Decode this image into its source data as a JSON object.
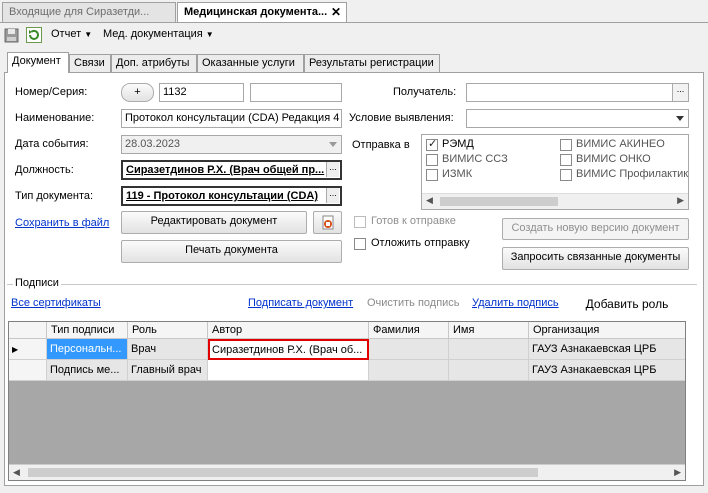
{
  "doc_tabs": [
    {
      "label": "Входящие  для  Сиразетди..."
    },
    {
      "label": "Медицинская документа..."
    }
  ],
  "toolbar": {
    "report_label": "Отчет",
    "med_doc_label": "Мед. документация"
  },
  "tabs": [
    {
      "label": "Документ"
    },
    {
      "label": "Связи"
    },
    {
      "label": "Доп. атрибуты"
    },
    {
      "label": "Оказанные услуги"
    },
    {
      "label": "Результаты регистрации"
    }
  ],
  "form": {
    "number_label": "Номер/Серия:",
    "plus_label": "+",
    "number_value": "1132",
    "series_value": "",
    "name_label": "Наименование:",
    "name_value": "Протокол консультации (CDA) Редакция 4",
    "event_date_label": "Дата события:",
    "event_date_value": "28.03.2023",
    "position_label": "Должность:",
    "position_value": "Сиразетдинов Р.Х. (Врач общей пр...",
    "doctype_label": "Тип документа:",
    "doctype_value": "119 - Протокол консультации (CDA)",
    "recipient_label": "Получатель:",
    "recipient_value": "",
    "condition_label": "Условие выявления:",
    "condition_value": "",
    "send_label": "Отправка в",
    "ellipsis": "..."
  },
  "send_options": [
    {
      "label": "РЭМД",
      "checked": true
    },
    {
      "label": "ВИМИС АКИНЕО",
      "checked": false
    },
    {
      "label": "ВИМИС ССЗ",
      "checked": false
    },
    {
      "label": "ВИМИС ОНКО",
      "checked": false
    },
    {
      "label": "ИЗМК",
      "checked": false
    },
    {
      "label": "ВИМИС Профилактик",
      "checked": false
    }
  ],
  "actions": {
    "save_file": "Сохранить в файл",
    "edit_doc": "Редактировать документ",
    "print_doc": "Печать документа",
    "ready_send": "Готов к отправке",
    "postpone_send": "Отложить отправку",
    "new_version": "Создать  новую версию документ",
    "request_linked": "Запросить связанные документы"
  },
  "signatures": {
    "group_label": "Подписи",
    "all_certs": "Все сертификаты",
    "sign_doc": "Подписать документ",
    "clear_sig": "Очистить подпись",
    "delete_sig": "Удалить подпись",
    "add_role": "Добавить роль",
    "columns": [
      "Тип подписи",
      "Роль",
      "Автор",
      "Фамилия",
      "Имя",
      "Организация"
    ],
    "rows": [
      {
        "type": "Персональн...",
        "role": "Врач",
        "author": "Сиразетдинов Р.Х. (Врач об...",
        "surname": "",
        "name": "",
        "org": "ГАУЗ Азнакаевская ЦРБ"
      },
      {
        "type": "Подпись ме...",
        "role": "Главный врач",
        "author": "",
        "surname": "",
        "name": "",
        "org": "ГАУЗ Азнакаевская ЦРБ"
      }
    ]
  },
  "colors": {
    "accent_border": "#e00000",
    "selection": "#3399ff",
    "link": "#0033cc"
  }
}
